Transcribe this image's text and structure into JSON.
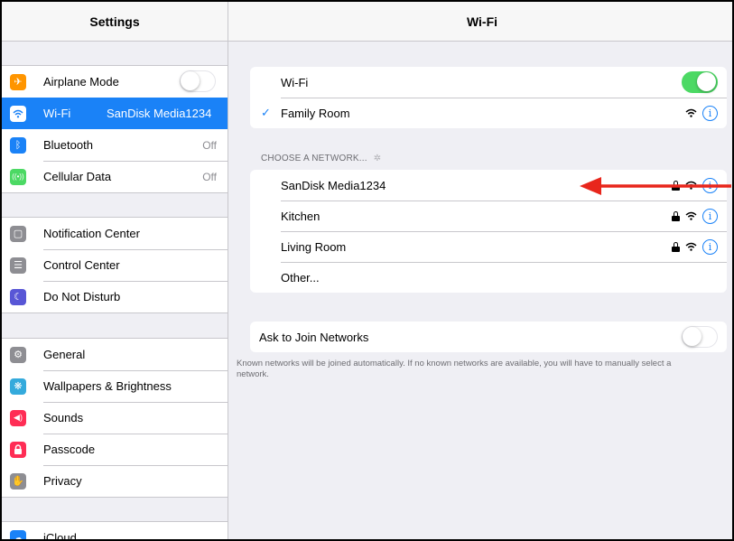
{
  "sidebar": {
    "title": "Settings",
    "groups": [
      {
        "items": [
          {
            "icon": "airplane-icon",
            "glyph": "✈",
            "color": "#ff9500",
            "label": "Airplane Mode",
            "value": "",
            "toggle": "off"
          },
          {
            "icon": "wifi-icon",
            "glyph": "◠",
            "color": "#1a82f7",
            "label": "Wi-Fi",
            "value": "SanDisk Media1234",
            "selected": true
          },
          {
            "icon": "bluetooth-icon",
            "glyph": "ᛒ",
            "color": "#1a82f7",
            "label": "Bluetooth",
            "value": "Off"
          },
          {
            "icon": "cellular-icon",
            "glyph": "((●))",
            "color": "#4cd964",
            "label": "Cellular Data",
            "value": "Off"
          }
        ]
      },
      {
        "items": [
          {
            "icon": "notification-center-icon",
            "glyph": "▢",
            "color": "#8e8e93",
            "label": "Notification Center"
          },
          {
            "icon": "control-center-icon",
            "glyph": "☰",
            "color": "#8e8e93",
            "label": "Control Center"
          },
          {
            "icon": "moon-icon",
            "glyph": "☾",
            "color": "#5856d6",
            "label": "Do Not Disturb"
          }
        ]
      },
      {
        "items": [
          {
            "icon": "gear-icon",
            "glyph": "⚙",
            "color": "#8e8e93",
            "label": "General"
          },
          {
            "icon": "wallpaper-icon",
            "glyph": "❋",
            "color": "#34aadc",
            "label": "Wallpapers & Brightness"
          },
          {
            "icon": "speaker-icon",
            "glyph": "◀)",
            "color": "#ff2d55",
            "label": "Sounds"
          },
          {
            "icon": "passcode-lock-icon",
            "glyph": "▣",
            "color": "#ff2d55",
            "label": "Passcode"
          },
          {
            "icon": "privacy-hand-icon",
            "glyph": "✋",
            "color": "#8e8e93",
            "label": "Privacy"
          }
        ]
      },
      {
        "items": [
          {
            "icon": "icloud-icon",
            "glyph": "☁",
            "color": "#1a82f7",
            "label": "iCloud"
          }
        ]
      }
    ]
  },
  "detail": {
    "title": "Wi-Fi",
    "wifi_label": "Wi-Fi",
    "wifi_toggle": "on",
    "connected_network": "Family Room",
    "choose_header": "CHOOSE A NETWORK...",
    "networks": [
      {
        "name": "SanDisk Media1234",
        "locked": true
      },
      {
        "name": "Kitchen",
        "locked": true
      },
      {
        "name": "Living Room",
        "locked": true
      },
      {
        "name": "Other...",
        "locked": false,
        "other": true
      }
    ],
    "ask_join_label": "Ask to Join Networks",
    "ask_join_toggle": "off",
    "footnote": "Known networks will be joined automatically. If no known networks are available, you will have to manually select a network.",
    "info_glyph": "i"
  },
  "annotation": {
    "arrow_color": "#e8261c"
  },
  "colors": {
    "accent": "#1a82f7",
    "toggle_on": "#4cd964"
  }
}
